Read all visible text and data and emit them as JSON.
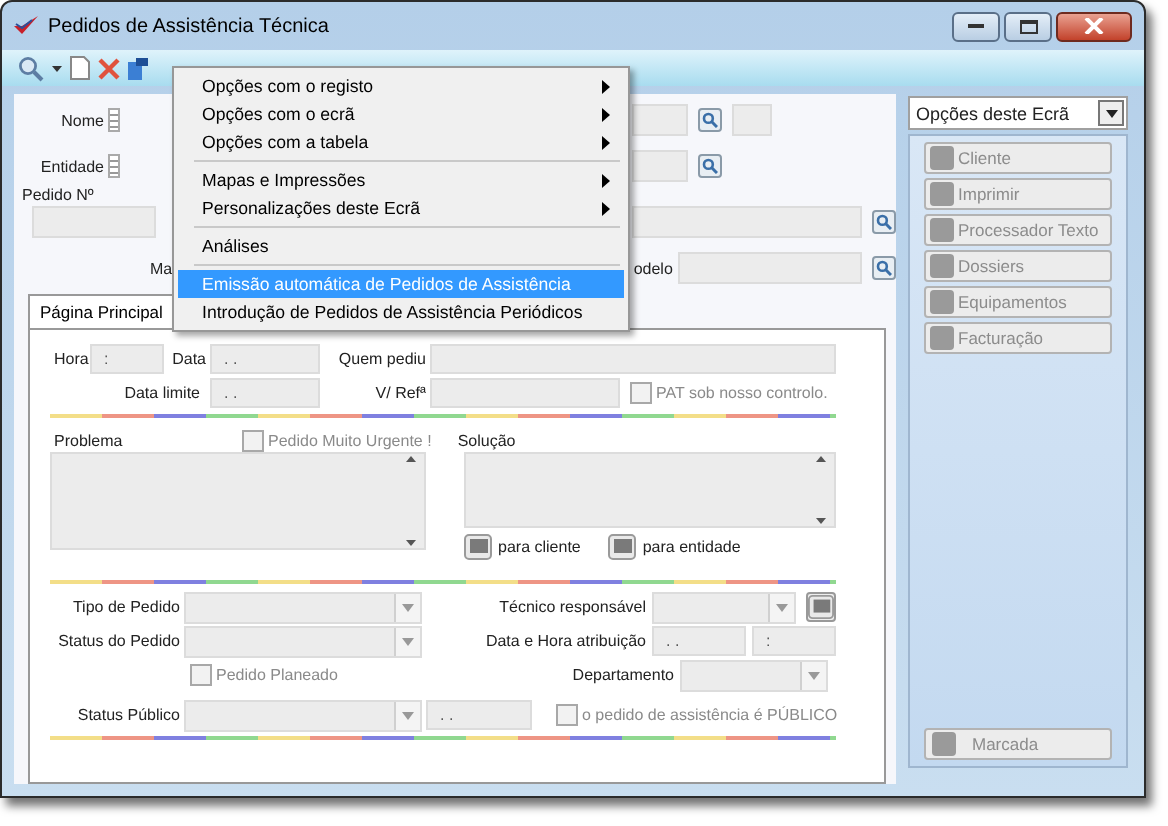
{
  "window": {
    "title": "Pedidos de Assistência Técnica"
  },
  "menu": [
    {
      "kind": "submenu",
      "label": "Opções com o registo",
      "selected": false
    },
    {
      "kind": "submenu",
      "label": "Opções com o ecrã",
      "selected": false
    },
    {
      "kind": "submenu",
      "label": "Opções com a tabela",
      "selected": false
    },
    {
      "kind": "separator"
    },
    {
      "kind": "submenu",
      "label": "Mapas e Impressões",
      "selected": false
    },
    {
      "kind": "submenu",
      "label": "Personalizações deste Ecrã",
      "selected": false
    },
    {
      "kind": "separator"
    },
    {
      "kind": "item",
      "label": "Análises",
      "selected": false
    },
    {
      "kind": "separator"
    },
    {
      "kind": "item",
      "label": "Emissão automática de Pedidos de Assistência",
      "selected": true
    },
    {
      "kind": "item",
      "label": "Introdução de Pedidos de Assistência Periódicos",
      "selected": false
    }
  ],
  "header": {
    "nome_label": "Nome",
    "entidade_label": "Entidade",
    "pedido_label": "Pedido Nº",
    "partial_label_left": "Ma",
    "partial_label_right": "odelo"
  },
  "tab": {
    "label": "Página Principal",
    "selected": true
  },
  "hora": {
    "label": "Hora",
    "value": ":"
  },
  "data": {
    "label": "Data",
    "value": ". ."
  },
  "quem_pediu": {
    "label": "Quem pediu"
  },
  "data_limite": {
    "label": "Data limite",
    "value": ". ."
  },
  "v_ref": {
    "label": "V/ Refª"
  },
  "pat": {
    "label": "PAT sob nosso controlo.",
    "checked": false
  },
  "problema": {
    "label": "Problema"
  },
  "urgente": {
    "label": "Pedido Muito Urgente !",
    "checked": false
  },
  "solucao": {
    "label": "Solução"
  },
  "note_buttons": [
    "para cliente",
    "para entidade"
  ],
  "tipo_pedido": {
    "label": "Tipo de Pedido"
  },
  "tecnico": {
    "label": "Técnico responsável"
  },
  "status_pedido": {
    "label": "Status do Pedido"
  },
  "data_hora": {
    "label": "Data e Hora atribuição",
    "date": ". .",
    "time": ":"
  },
  "planeado": {
    "label": "Pedido Planeado",
    "checked": false
  },
  "departamento": {
    "label": "Departamento"
  },
  "status_publico": {
    "label": "Status Público",
    "date": ". ."
  },
  "publico": {
    "label": "o pedido de assistência é PÚBLICO",
    "checked": false
  },
  "side_panel": {
    "dropdown": "Opções deste Ecrã",
    "buttons": [
      {
        "label": "Cliente",
        "disabled": true
      },
      {
        "label": "Imprimir",
        "disabled": true
      },
      {
        "label": "Processador Texto",
        "disabled": true
      },
      {
        "label": "Dossiers",
        "disabled": true
      },
      {
        "label": "Equipamentos",
        "disabled": true
      },
      {
        "label": "Facturação",
        "disabled": true
      }
    ],
    "marcada": {
      "label": "Marcada",
      "disabled": true
    }
  }
}
